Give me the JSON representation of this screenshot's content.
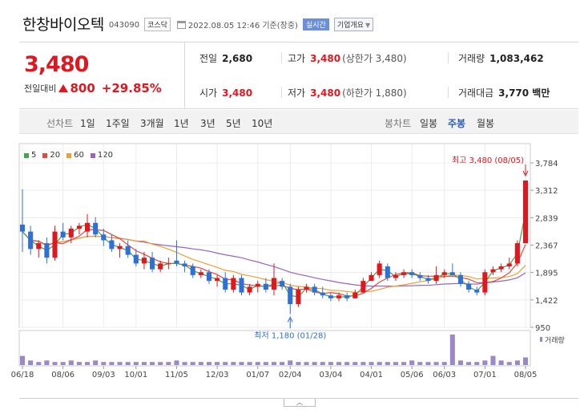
{
  "header": {
    "name": "한창바이오텍",
    "code": "043090",
    "market": "코스닥",
    "datetime": "2022.08.05 12:46 기준(장중)",
    "realtime": "실시간",
    "company_info": "기업개요"
  },
  "quote": {
    "price": "3,480",
    "change_label": "전일대비",
    "change_value": "800",
    "change_rate": "+29.85%",
    "prev_close_label": "전일",
    "prev_close": "2,680",
    "high_label": "고가",
    "high": "3,480",
    "upper_limit": "(상한가 3,480)",
    "volume_label": "거래량",
    "volume": "1,083,462",
    "open_label": "시가",
    "open": "3,480",
    "low_label": "저가",
    "low": "3,480",
    "lower_limit": "(하한가 1,880)",
    "amount_label": "거래대금",
    "amount": "3,770 백만"
  },
  "tabs": {
    "line_chart": "선차트",
    "periods": [
      "1일",
      "1주일",
      "3개월",
      "1년",
      "3년",
      "5년",
      "10년"
    ],
    "candle_chart": "봉차트",
    "candle_types": [
      "일봉",
      "주봉",
      "월봉"
    ],
    "active_candle": "주봉"
  },
  "colors": {
    "up": "#e0171f",
    "down": "#2f6fd6",
    "ma5": "#3aa84a",
    "ma20": "#e24a3b",
    "ma60": "#f0a030",
    "ma120": "#9a62c4",
    "volume": "#9b88c9"
  },
  "chart_data": {
    "type": "candlestick",
    "legend": [
      {
        "name": "5",
        "color": "#3aa84a"
      },
      {
        "name": "20",
        "color": "#e24a3b"
      },
      {
        "name": "60",
        "color": "#f0a030"
      },
      {
        "name": "120",
        "color": "#9a62c4"
      }
    ],
    "y_ticks": [
      "3,784",
      "3,312",
      "2,839",
      "2,367",
      "1,895",
      "1,422",
      "950"
    ],
    "ylim": [
      950,
      3784
    ],
    "x_ticks": [
      "06/18",
      "08/06",
      "09/03",
      "10/01",
      "11/05",
      "12/03",
      "01/07",
      "02/04",
      "03/04",
      "04/01",
      "05/06",
      "06/03",
      "07/01",
      "08/05"
    ],
    "high_annotation": "최고 3,480 (08/05)",
    "low_annotation": "최저 1,180 (01/28)",
    "volume_label": "거래량",
    "candles": [
      {
        "o": 2720,
        "h": 3330,
        "l": 2250,
        "c": 2600
      },
      {
        "o": 2600,
        "h": 2700,
        "l": 2200,
        "c": 2300
      },
      {
        "o": 2300,
        "h": 2450,
        "l": 2150,
        "c": 2400
      },
      {
        "o": 2400,
        "h": 2500,
        "l": 2050,
        "c": 2150
      },
      {
        "o": 2150,
        "h": 2700,
        "l": 2100,
        "c": 2600
      },
      {
        "o": 2600,
        "h": 2750,
        "l": 2450,
        "c": 2500
      },
      {
        "o": 2500,
        "h": 2700,
        "l": 2400,
        "c": 2650
      },
      {
        "o": 2650,
        "h": 2750,
        "l": 2550,
        "c": 2700
      },
      {
        "o": 2600,
        "h": 2900,
        "l": 2500,
        "c": 2750
      },
      {
        "o": 2750,
        "h": 2850,
        "l": 2500,
        "c": 2550
      },
      {
        "o": 2550,
        "h": 2650,
        "l": 2350,
        "c": 2450
      },
      {
        "o": 2450,
        "h": 2550,
        "l": 2250,
        "c": 2300
      },
      {
        "o": 2300,
        "h": 2400,
        "l": 2150,
        "c": 2350
      },
      {
        "o": 2350,
        "h": 2450,
        "l": 2150,
        "c": 2200
      },
      {
        "o": 2200,
        "h": 2300,
        "l": 2000,
        "c": 2050
      },
      {
        "o": 2050,
        "h": 2250,
        "l": 1950,
        "c": 2150
      },
      {
        "o": 2150,
        "h": 2250,
        "l": 1900,
        "c": 1950
      },
      {
        "o": 1950,
        "h": 2100,
        "l": 1900,
        "c": 2050
      },
      {
        "o": 2050,
        "h": 2150,
        "l": 1950,
        "c": 2050
      },
      {
        "o": 2100,
        "h": 2450,
        "l": 2000,
        "c": 2050
      },
      {
        "o": 2050,
        "h": 2100,
        "l": 1900,
        "c": 2000
      },
      {
        "o": 2000,
        "h": 2050,
        "l": 1800,
        "c": 1850
      },
      {
        "o": 1850,
        "h": 1950,
        "l": 1800,
        "c": 1900
      },
      {
        "o": 1900,
        "h": 1950,
        "l": 1700,
        "c": 1750
      },
      {
        "o": 1750,
        "h": 1850,
        "l": 1650,
        "c": 1800
      },
      {
        "o": 1800,
        "h": 1900,
        "l": 1550,
        "c": 1600
      },
      {
        "o": 1600,
        "h": 1850,
        "l": 1550,
        "c": 1800
      },
      {
        "o": 1800,
        "h": 1850,
        "l": 1500,
        "c": 1550
      },
      {
        "o": 1550,
        "h": 1700,
        "l": 1500,
        "c": 1650
      },
      {
        "o": 1650,
        "h": 1750,
        "l": 1550,
        "c": 1700
      },
      {
        "o": 1700,
        "h": 1800,
        "l": 1550,
        "c": 1600
      },
      {
        "o": 1600,
        "h": 2050,
        "l": 1500,
        "c": 1800
      },
      {
        "o": 1750,
        "h": 1800,
        "l": 1600,
        "c": 1650
      },
      {
        "o": 1650,
        "h": 1700,
        "l": 1180,
        "c": 1350
      },
      {
        "o": 1350,
        "h": 1650,
        "l": 1300,
        "c": 1600
      },
      {
        "o": 1600,
        "h": 1700,
        "l": 1550,
        "c": 1650
      },
      {
        "o": 1650,
        "h": 1700,
        "l": 1500,
        "c": 1550
      },
      {
        "o": 1550,
        "h": 1650,
        "l": 1450,
        "c": 1500
      },
      {
        "o": 1500,
        "h": 1550,
        "l": 1400,
        "c": 1450
      },
      {
        "o": 1450,
        "h": 1550,
        "l": 1400,
        "c": 1500
      },
      {
        "o": 1500,
        "h": 1550,
        "l": 1400,
        "c": 1450
      },
      {
        "o": 1450,
        "h": 1600,
        "l": 1450,
        "c": 1550
      },
      {
        "o": 1550,
        "h": 1800,
        "l": 1550,
        "c": 1750
      },
      {
        "o": 1750,
        "h": 1900,
        "l": 1750,
        "c": 1850
      },
      {
        "o": 1850,
        "h": 2100,
        "l": 1800,
        "c": 2050
      },
      {
        "o": 2000,
        "h": 2050,
        "l": 1750,
        "c": 1800
      },
      {
        "o": 1800,
        "h": 1900,
        "l": 1750,
        "c": 1850
      },
      {
        "o": 1850,
        "h": 1950,
        "l": 1800,
        "c": 1900
      },
      {
        "o": 1900,
        "h": 1950,
        "l": 1800,
        "c": 1850
      },
      {
        "o": 1850,
        "h": 1900,
        "l": 1750,
        "c": 1800
      },
      {
        "o": 1800,
        "h": 1850,
        "l": 1700,
        "c": 1750
      },
      {
        "o": 1750,
        "h": 2000,
        "l": 1700,
        "c": 1850
      },
      {
        "o": 1850,
        "h": 1950,
        "l": 1800,
        "c": 1900
      },
      {
        "o": 1900,
        "h": 2050,
        "l": 1850,
        "c": 1850
      },
      {
        "o": 1850,
        "h": 1900,
        "l": 1650,
        "c": 1700
      },
      {
        "o": 1700,
        "h": 1750,
        "l": 1550,
        "c": 1600
      },
      {
        "o": 1600,
        "h": 1650,
        "l": 1500,
        "c": 1550
      },
      {
        "o": 1550,
        "h": 1950,
        "l": 1500,
        "c": 1900
      },
      {
        "o": 1900,
        "h": 2000,
        "l": 1850,
        "c": 1950
      },
      {
        "o": 1950,
        "h": 2050,
        "l": 1900,
        "c": 2000
      },
      {
        "o": 2000,
        "h": 2150,
        "l": 1950,
        "c": 2050
      },
      {
        "o": 2050,
        "h": 2450,
        "l": 2000,
        "c": 2400
      },
      {
        "o": 2400,
        "h": 3480,
        "l": 2400,
        "c": 3480
      }
    ],
    "volumes": [
      6,
      3,
      2,
      3,
      2,
      2,
      3,
      2,
      2,
      3,
      2,
      2,
      2,
      2,
      2,
      2,
      2,
      2,
      2,
      3,
      2,
      2,
      2,
      2,
      2,
      2,
      2,
      2,
      2,
      2,
      2,
      2,
      2,
      3,
      2,
      2,
      2,
      2,
      2,
      2,
      2,
      2,
      2,
      2,
      2,
      2,
      2,
      2,
      3,
      2,
      2,
      2,
      2,
      20,
      3,
      2,
      2,
      3,
      6,
      3,
      2,
      3,
      5
    ]
  }
}
